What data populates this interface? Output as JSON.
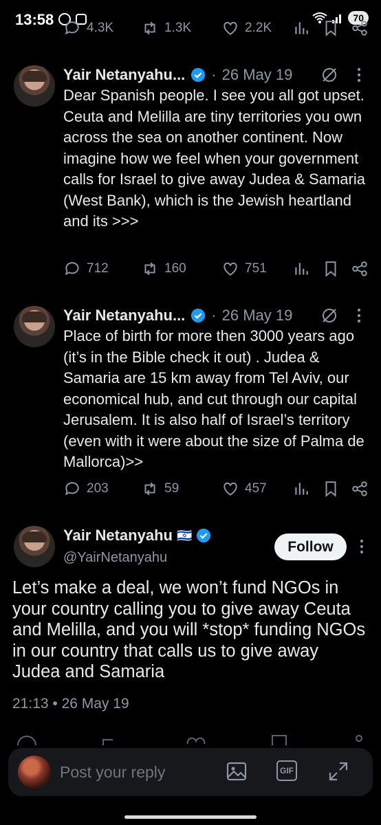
{
  "status_bar": {
    "time": "13:58",
    "battery": "70"
  },
  "top_actions": {
    "replies": "4.3K",
    "reposts": "1.3K",
    "likes": "2.2K"
  },
  "tweets": [
    {
      "author": "Yair Netanyahu...",
      "date": "26 May 19",
      "text": "Dear Spanish people. I see you all got upset. Ceuta and Melilla are tiny territories you own across the sea on another continent. Now imagine how we feel when your government calls for Israel to give away Judea & Samaria (West Bank), which is the Jewish heartland and its >>>",
      "replies": "712",
      "reposts": "160",
      "likes": "751"
    },
    {
      "author": "Yair Netanyahu...",
      "date": "26 May 19",
      "text": "Place of birth for more then 3000 years ago (it’s in the Bible check it out) . Judea & Samaria are 15 km away from Tel Aviv, our economical hub, and cut through our capital Jerusalem. It is also half of Israel’s territory (even with it were about the size of Palma de Mallorca)>>",
      "replies": "203",
      "reposts": "59",
      "likes": "457"
    }
  ],
  "main_tweet": {
    "author": "Yair Netanyahu",
    "flag": "🇮🇱",
    "handle": "@YairNetanyahu",
    "follow_label": "Follow",
    "text": "Let’s make a deal, we won’t fund NGOs in your country calling you to give away Ceuta and Melilla, and you will *stop* funding NGOs in our country that calls us to give away Judea and Samaria",
    "timestamp": "21:13 • 26 May 19"
  },
  "reply_bar": {
    "placeholder": "Post your reply",
    "gif_label": "GIF"
  },
  "colors": {
    "background": "#000000",
    "text": "#e7e9ea",
    "muted": "#8b98a5",
    "verified": "#1d9bf0"
  }
}
